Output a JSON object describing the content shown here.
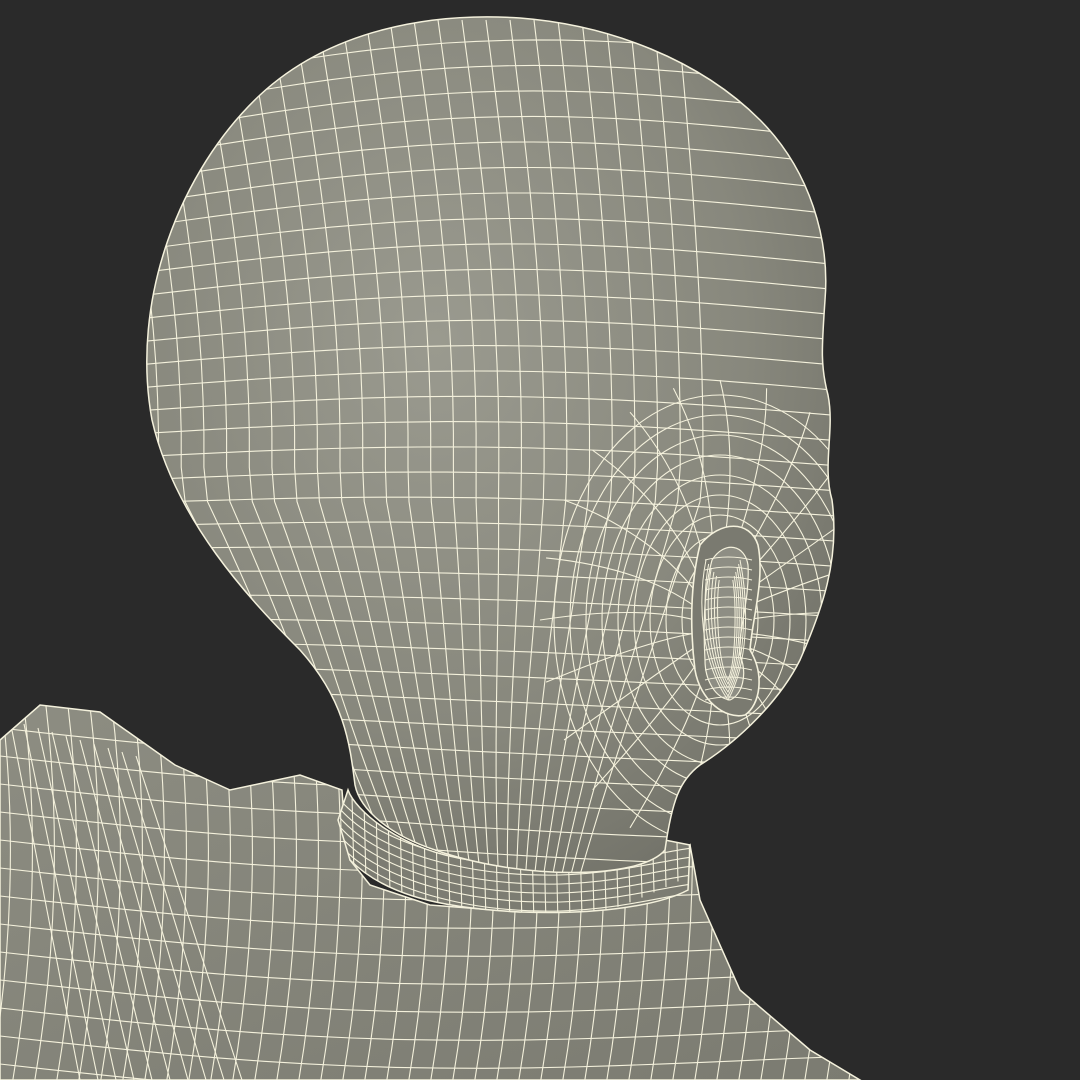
{
  "scene": {
    "subject": "3d-wireframe-mannequin-head-shoulders",
    "colors": {
      "background": "#2a2a2a",
      "surface": "#8a8a7f",
      "surface_shadow": "#6f6f66",
      "surface_highlight": "#9c9c91",
      "wire": "#f4f1dc"
    }
  }
}
